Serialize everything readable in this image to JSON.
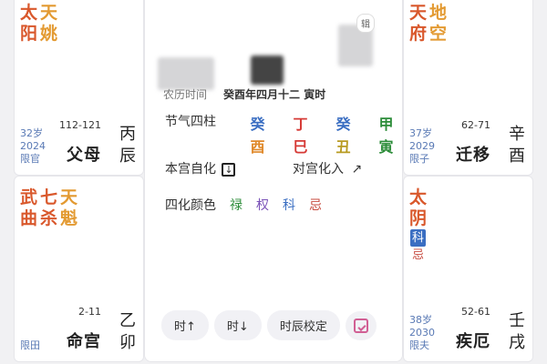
{
  "left_top": {
    "stars": [
      {
        "chars": [
          "太",
          "阳"
        ],
        "color": "#d9582c"
      },
      {
        "chars": [
          "天",
          "姚"
        ],
        "color": "#e39a32"
      }
    ],
    "age": "32岁",
    "year": "2024",
    "limit": "限官",
    "range": "112-121",
    "palace": "父母",
    "ganzhi": [
      "丙",
      "辰"
    ]
  },
  "left_mid": {
    "stars": [
      {
        "chars": [
          "武",
          "曲"
        ],
        "color": "#d9582c"
      },
      {
        "chars": [
          "七",
          "杀"
        ],
        "color": "#d9582c"
      },
      {
        "chars": [
          "天",
          "魁"
        ],
        "color": "#e39a32"
      }
    ],
    "limit": "限田",
    "range": "2-11",
    "palace": "命宫",
    "ganzhi": [
      "乙",
      "卯"
    ]
  },
  "right_top": {
    "stars": [
      {
        "chars": [
          "天",
          "府"
        ],
        "color": "#d9582c"
      },
      {
        "chars": [
          "地",
          "空"
        ],
        "color": "#e39a32"
      }
    ],
    "age": "37岁",
    "year": "2029",
    "limit": "限子",
    "range": "62-71",
    "palace": "迁移",
    "ganzhi": [
      "辛",
      "酉"
    ]
  },
  "right_mid": {
    "star": [
      "太",
      "阴"
    ],
    "hua": [
      "科",
      "忌"
    ],
    "age": "38岁",
    "year": "2030",
    "limit": "限夫",
    "range": "52-61",
    "palace": "疾厄",
    "ganzhi": [
      "壬",
      "戌"
    ]
  },
  "center": {
    "edit_label": "辑",
    "lunar_label": "农历时间",
    "lunar_value": "癸酉年四月十二 寅时",
    "jieqi_label": "节气四柱",
    "stems": [
      "癸",
      "丁",
      "癸",
      "甲"
    ],
    "branches": [
      "酉",
      "巳",
      "丑",
      "寅"
    ],
    "self_hua_label": "本宫自化",
    "opposite_hua_label": "对宫化入",
    "colors_label": "四化颜色",
    "color_samples": [
      "禄",
      "权",
      "科",
      "忌"
    ],
    "buttons": {
      "hour_up": "时↑",
      "hour_down": "时↓",
      "calibrate": "时辰校定"
    }
  }
}
